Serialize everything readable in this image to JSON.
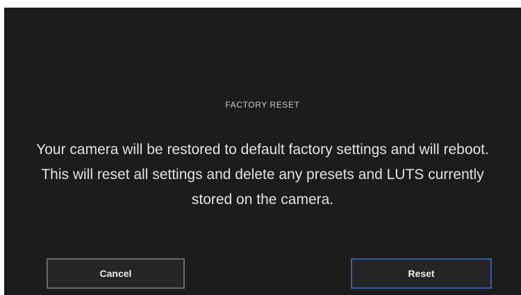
{
  "dialog": {
    "title": "FACTORY RESET",
    "message": "Your camera will be restored to default factory settings and will reboot. This will reset all settings and delete any presets and LUTS currently stored on the camera.",
    "cancel_label": "Cancel",
    "reset_label": "Reset"
  },
  "colors": {
    "background": "#1c1c1d",
    "reset_border_accent": "#2f5fa8"
  }
}
